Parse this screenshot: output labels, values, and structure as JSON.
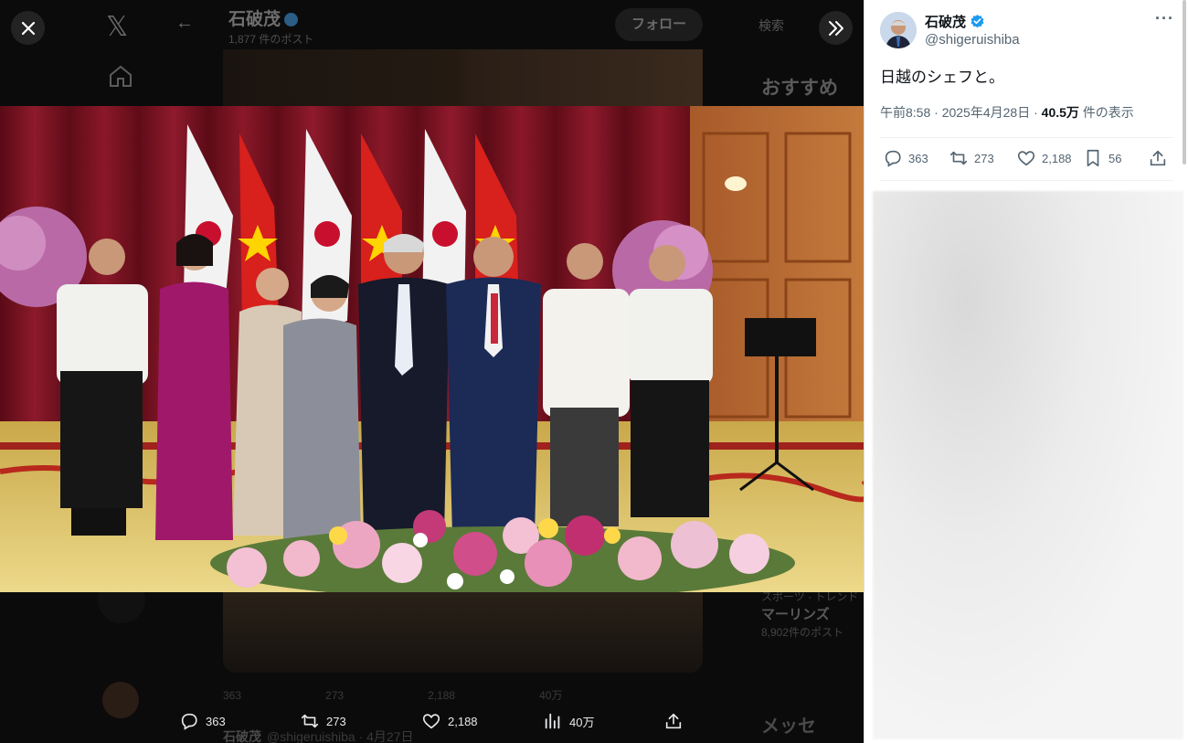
{
  "background": {
    "logo": "𝕏",
    "back_arrow": "←",
    "profile_name": "石破茂",
    "posts_count": "1,877 件のポスト",
    "follow_label": "フォロー",
    "search_placeholder": "検索",
    "recommend_heading": "おすすめ",
    "stats": [
      "363",
      "273",
      "2,188",
      "40万"
    ],
    "post2_name": "石破茂",
    "post2_handle": "@shigeruishiba · 4月27日",
    "trend_category": "スポーツ · トレンド",
    "trend_name": "マーリンズ",
    "trend_count": "8,902件のポスト",
    "messages_label": "メッセ"
  },
  "viewer": {
    "close_icon": "close-icon",
    "expand_icon": "double-chevron-right-icon",
    "bottom_actions": {
      "replies": "363",
      "reposts": "273",
      "likes": "2,188",
      "views": "40万"
    }
  },
  "panel": {
    "display_name": "石破茂",
    "handle": "@shigeruishiba",
    "more": "···",
    "post_text": "日越のシェフと。",
    "time": "午前8:58",
    "date": "2025年4月28日",
    "views_number": "40.5万",
    "views_suffix": "件の表示",
    "actions": {
      "replies": "363",
      "reposts": "273",
      "likes": "2,188",
      "bookmarks": "56"
    }
  },
  "colors": {
    "accent": "#1d9bf0",
    "text_secondary": "#536471",
    "curtain": "#7a1020",
    "carpet": "#e2cd70"
  }
}
